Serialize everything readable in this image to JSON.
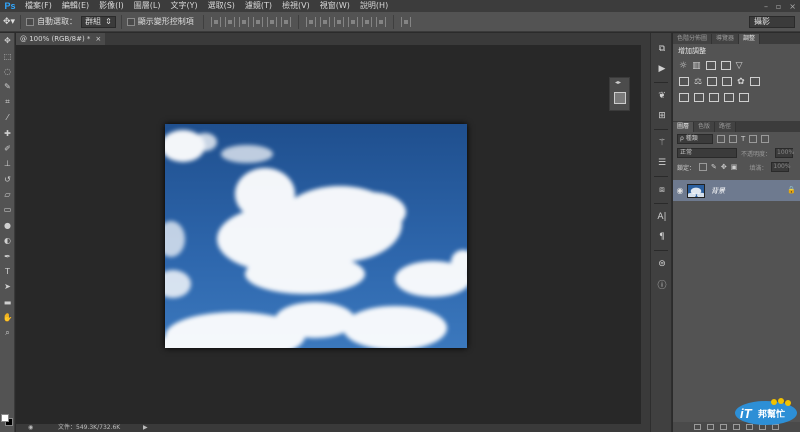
{
  "app": {
    "logo": "Ps"
  },
  "menu": {
    "items": [
      "檔案(F)",
      "編輯(E)",
      "影像(I)",
      "圖層(L)",
      "文字(Y)",
      "選取(S)",
      "濾鏡(T)",
      "檢視(V)",
      "視窗(W)",
      "說明(H)"
    ]
  },
  "options_bar": {
    "auto_select_label": "自動選取：",
    "auto_select_value": "群組",
    "show_transform_label": "顯示變形控制項",
    "workspace": "攝影"
  },
  "document": {
    "tab_title": "@ 100% (RGB/8#) *",
    "tab_close": "×",
    "status_doc": "文件：549.3K/732.6K"
  },
  "panels": {
    "top_tabs": [
      "色階分佈圖",
      "導覽器",
      "調整"
    ],
    "adjust_title": "增加調整",
    "layer_tabs": [
      "圖層",
      "色版",
      "路徑"
    ],
    "kind_filter": "ρ 種類",
    "blend_mode": "正常",
    "opacity_label": "不透明度：",
    "opacity_value": "100%",
    "lock_label": "鎖定：",
    "fill_label": "填滿：",
    "fill_value": "100%",
    "layer_name": "背景",
    "lock_icon": "🔒"
  },
  "icons": {
    "tools": [
      "move-icon",
      "marquee-icon",
      "lasso-icon",
      "quick-select-icon",
      "crop-icon",
      "eyedropper-icon",
      "healing-icon",
      "brush-icon",
      "stamp-icon",
      "history-brush-icon",
      "eraser-icon",
      "gradient-icon",
      "blur-icon",
      "dodge-icon",
      "pen-icon",
      "type-icon",
      "path-select-icon",
      "shape-icon",
      "hand-icon",
      "zoom-icon"
    ],
    "dock": [
      "history-icon",
      "actions-icon",
      "brush-presets-icon",
      "clone-source-icon",
      "tool-presets-icon",
      "layer-comps-icon",
      "character-icon",
      "paragraph-icon",
      "3d-icon",
      "info-icon"
    ]
  },
  "colors": {
    "accent": "#31a8ff",
    "selected_layer": "#6e7a8f"
  },
  "watermark": {
    "text": "iT邦幫忙"
  }
}
